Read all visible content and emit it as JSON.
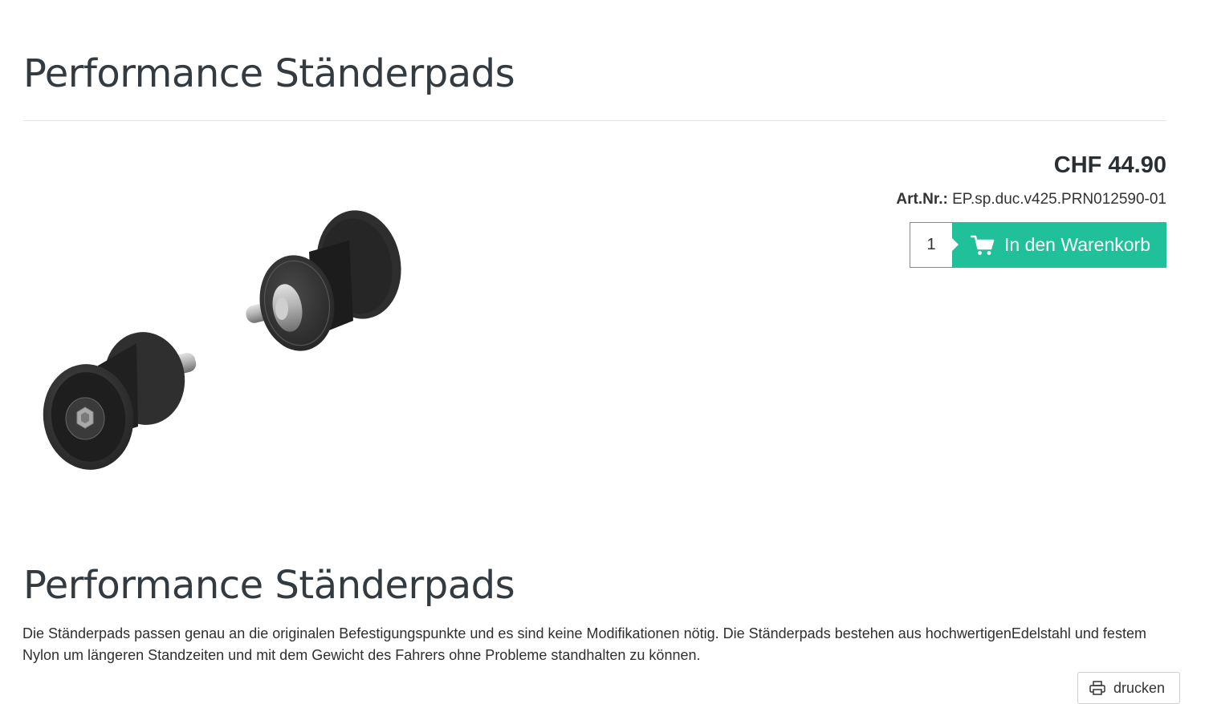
{
  "product": {
    "title": "Performance Ständerpads",
    "price": "CHF 44.90",
    "art_label": "Art.Nr.:",
    "art_number": "EP.sp.duc.v425.PRN012590-01",
    "image_alt": "Performance Ständerpads"
  },
  "cart": {
    "quantity": "1",
    "button_label": "In den Warenkorb",
    "icon": "cart-icon"
  },
  "description": {
    "heading": "Performance Ständerpads",
    "text": "Die Ständerpads passen genau an die originalen Befestigungspunkte und es sind keine Modifikationen nötig. Die Ständerpads bestehen aus hochwertigenEdelstahl und festem Nylon um längeren Standzeiten und mit dem Gewicht des Fahrers ohne Probleme standhalten zu können."
  },
  "actions": {
    "print_label": "drucken",
    "print_icon": "printer-icon"
  },
  "colors": {
    "accent": "#20c09a",
    "text_dark": "#333a40"
  }
}
